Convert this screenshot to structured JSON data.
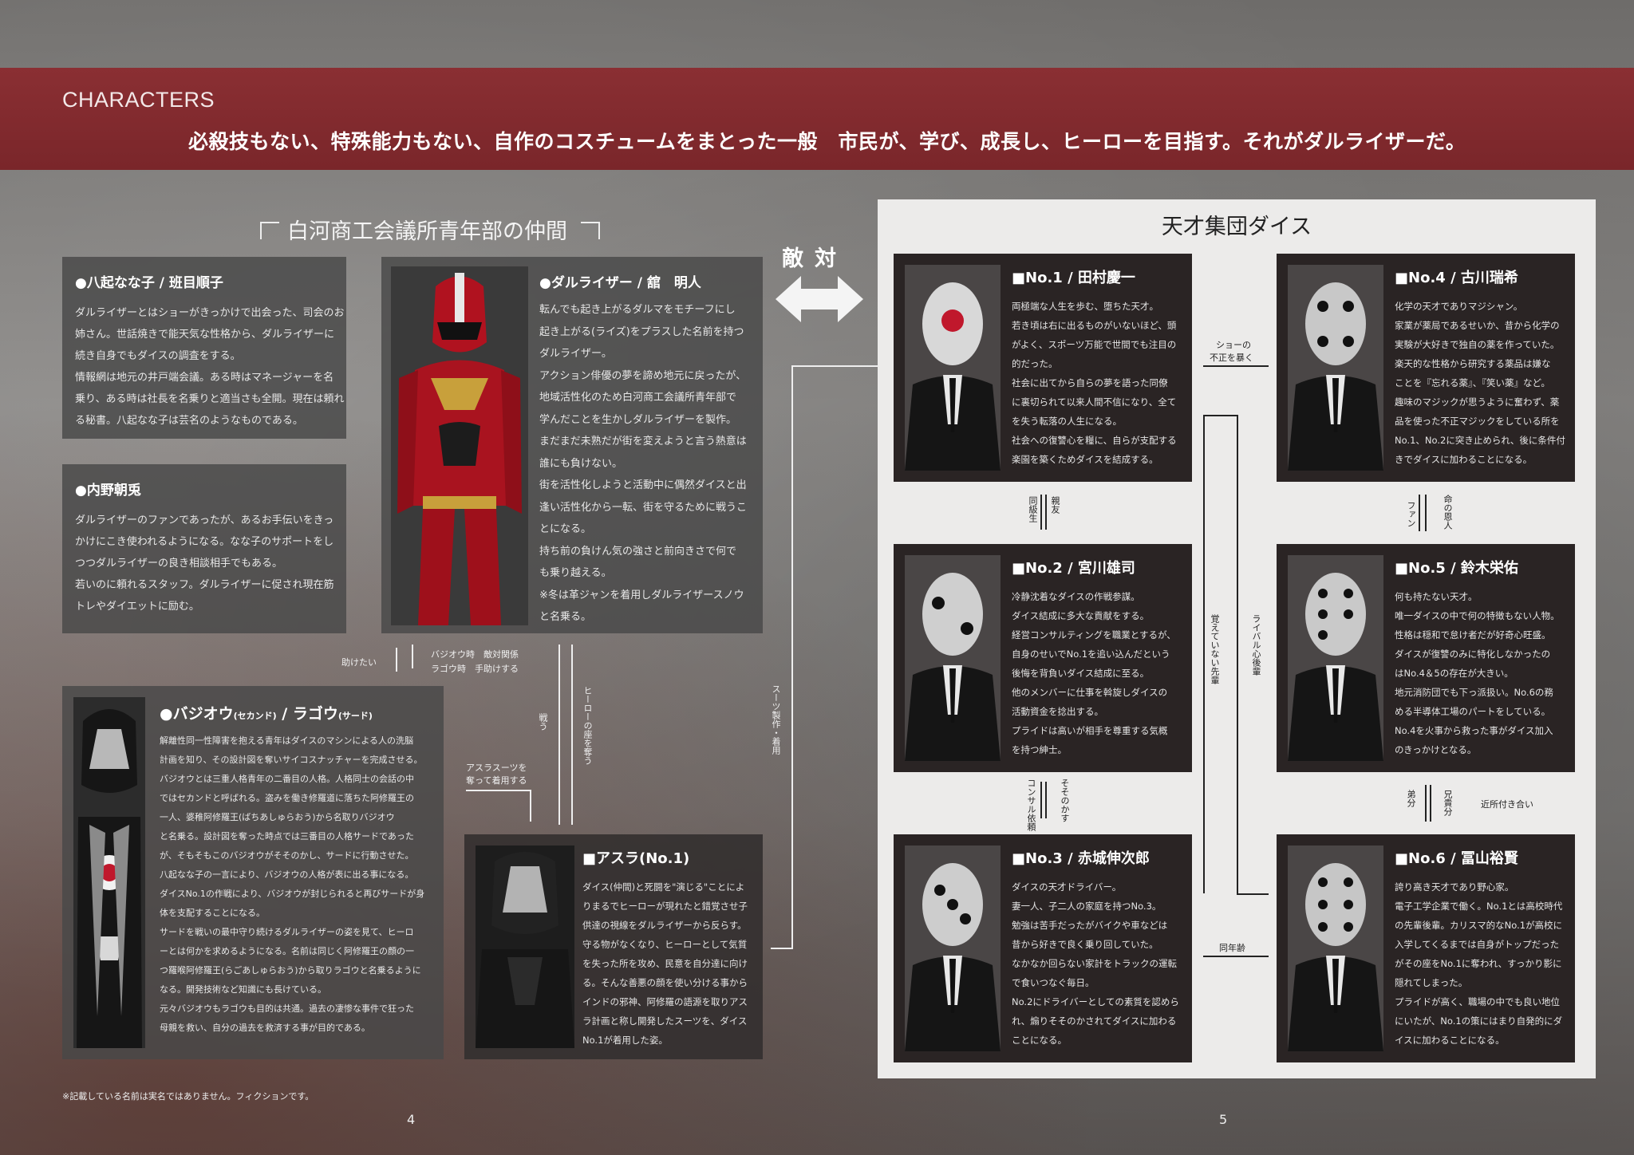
{
  "header": {
    "section_title": "CHARACTERS",
    "tagline": "必殺技もない、特殊能力もない、自作のコスチュームをまとった一般　市民が、学び、成長し、ヒーローを目指す。それがダルライザーだ。"
  },
  "left_group": {
    "title": "白河商工会議所青年部の仲間",
    "cards": [
      {
        "name": "●八起なな子 / 班目順子",
        "lines": [
          "ダルライザーとはショーがきっかけで出会った、司会のお",
          "姉さん。世話焼きで能天気な性格から、ダルライザーに",
          "続き自身でもダイスの調査をする。",
          "情報網は地元の井戸端会議。ある時はマネージャーを名",
          "乗り、ある時は社長を名乗りと適当さも全開。現在は頼れ",
          "る秘書。八起なな子は芸名のようなものである。"
        ]
      },
      {
        "name": "●内野朝兎",
        "lines": [
          "ダルライザーのファンであったが、あるお手伝いをきっ",
          "かけにこき使われるようになる。なな子のサポートをし",
          "つつダルライザーの良き相談相手でもある。",
          "若いのに頼れるスタッフ。ダルライザーに促され現在筋",
          "トレやダイエットに励む。"
        ]
      },
      {
        "name": "●ダルライザー / 舘　明人",
        "lines": [
          "転んでも起き上がるダルマをモチーフにし",
          "起き上がる(ライズ)をプラスした名前を持つ",
          "ダルライザー。",
          "アクション俳優の夢を諦め地元に戻ったが、",
          "地域活性化のため白河商工会議所青年部で",
          "学んだことを生かしダルライザーを製作。",
          "まだまだ未熟だが街を変えようと言う熱意は",
          "誰にも負けない。",
          "街を活性化しようと活動中に偶然ダイスと出",
          "逢い活性化から一転、街を守るために戦うこ",
          "とになる。",
          "持ち前の負けん気の強さと前向きさで何で",
          "も乗り越える。",
          "※冬は革ジャンを着用しダルライザースノウ",
          "と名乗る。"
        ]
      },
      {
        "name_main": "●バジオウ",
        "name_sub1": "(セカンド)",
        "name_mid": " / ラゴウ",
        "name_sub2": "(サード)",
        "lines": [
          "解離性同一性障害を抱える青年はダイスのマシンによる人の洗脳",
          "計画を知り、その設計図を奪いサイコスナッチャーを完成させる。",
          "バジオウとは三重人格青年の二番目の人格。人格同士の会話の中",
          "ではセカンドと呼ばれる。盗みを働き修羅道に落ちた阿修羅王の",
          "一人、婆稚阿修羅王(ばちあしゅらおう)から名取りバジオウ",
          "と名乗る。設計図を奪った時点では三番目の人格サードであった",
          "が、そもそもこのバジオウがそそのかし、サードに行動させた。",
          "八起なな子の一言により、バジオウの人格が表に出る事になる。",
          "ダイスNo.1の作戦により、バジオウが封じられると再びサードが身",
          "体を支配することになる。",
          "サードを戦いの最中守り続けるダルライザーの姿を見て、ヒーロ",
          "ーとは何かを求めるようになる。名前は同じく阿修羅王の顔の一",
          "つ羅喉阿修羅王(らごあしゅらおう)から取りラゴウと名乗るように",
          "なる。開発技術など知識にも長けている。",
          "元々バジオウもラゴウも目的は共通。過去の凄惨な事件で狂った",
          "母親を救い、自分の過去を救済する事が目的である。"
        ]
      },
      {
        "name": "■アスラ(No.1)",
        "lines": [
          "ダイス(仲間)と死闘を\"演じる\"ことによ",
          "りまるでヒーローが現れたと錯覚させ子",
          "供達の視線をダルライザーから反らす。",
          "守る物がなくなり、ヒーローとして気質",
          "を失った所を攻め、民意を自分達に向け",
          "る。そんな善悪の顔を使い分ける事から",
          "インドの邪神、阿修羅の語源を取りアス",
          "ラ計画と称し開発したスーツを、ダイス",
          "No.1が着用した姿。"
        ]
      }
    ],
    "relations": {
      "help": "助けたい",
      "bajio_rel1": "バジオウ時　敵対関係",
      "bajio_rel2": "ラゴウ時　手助けする",
      "asura_wear1": "アスラスーツを",
      "asura_wear2": "奪って着用する",
      "fight": "戦う",
      "hero_seat": "ヒーローの座を奪う",
      "suit": "スーツ製作・着用"
    }
  },
  "enemy_label": "敵対",
  "right_group": {
    "title": "天才集団ダイス",
    "members": [
      {
        "name": "■No.1 / 田村慶一",
        "lines": [
          "両極端な人生を歩む、堕ちた天才。",
          "若き頃は右に出るものがいないほど、頭",
          "がよく、スポーツ万能で世間でも注目の",
          "的だった。",
          "社会に出てから自らの夢を語った同僚",
          "に裏切られて以来人間不信になり、全て",
          "を失う転落の人生になる。",
          "社会への復讐心を糧に、自らが支配する",
          "楽園を築くためダイスを結成する。"
        ]
      },
      {
        "name": "■No.4 / 古川瑞希",
        "lines": [
          "化学の天才でありマジシャン。",
          "家業が薬局であるせいか、昔から化学の",
          "実験が大好きで独自の薬を作っていた。",
          "楽天的な性格から研究する薬品は嫌な",
          "ことを『忘れる薬』、『笑い薬』など。",
          "趣味のマジックが思うように奮わず、薬",
          "品を使った不正マジックをしている所を",
          "No.1、No.2に突き止められ、後に条件付",
          "きでダイスに加わることになる。"
        ]
      },
      {
        "name": "■No.2 / 宮川雄司",
        "lines": [
          "冷静沈着なダイスの作戦参謀。",
          "ダイス結成に多大な貢献をする。",
          "経営コンサルティングを職業とするが、",
          "自身のせいでNo.1を追い込んだという",
          "後悔を背負いダイス結成に至る。",
          "他のメンバーに仕事を斡旋しダイスの",
          "活動資金を捻出する。",
          "プライドは高いが相手を尊重する気概",
          "を持つ紳士。"
        ]
      },
      {
        "name": "■No.5 / 鈴木栄佑",
        "lines": [
          "何も持たない天才。",
          "唯一ダイスの中で何の特徴もない人物。",
          "性格は穏和で怠け者だが好奇心旺盛。",
          "ダイスが復讐のみに特化しなかったの",
          "はNo.4＆5の存在が大きい。",
          "地元消防団でも下っ派扱い。No.6の務",
          "める半導体工場のパートをしている。",
          "No.4を火事から救った事がダイス加入",
          "のきっかけとなる。"
        ]
      },
      {
        "name": "■No.3 / 赤城伸次郎",
        "lines": [
          "ダイスの天才ドライバー。",
          "妻一人、子二人の家庭を持つNo.3。",
          "勉強は苦手だったがバイクや車などは",
          "昔から好きで良く乗り回していた。",
          "なかなか回らない家計をトラックの運転",
          "で食いつなぐ毎日。",
          "No.2にドライバーとしての素質を認めら",
          "れ、煽りそそのかされてダイスに加わる",
          "ことになる。"
        ]
      },
      {
        "name": "■No.6 / 冨山裕賢",
        "lines": [
          "誇り高き天才であり野心家。",
          "電子工学企業で働く。No.1とは高校時代",
          "の先輩後輩。カリスマ的なNo.1が高校に",
          "入学してくるまでは自身がトップだった",
          "がその座をNo.1に奪われ、すっかり影に",
          "隠れてしまった。",
          "プライドが高く、職場の中でも良い地位",
          "にいたが、No.1の策にはまり自発的にダ",
          "イスに加わることになる。"
        ]
      }
    ],
    "relations": {
      "show1": "ショーの",
      "show2": "不正を暴く",
      "classmate": "同級生",
      "friend": "親友",
      "fan": "ファン",
      "savior": "命の恩人",
      "forgot": "覚えていない先輩",
      "rival": "ライバル心後輩",
      "consult": "コンサル依頼",
      "tempt": "そそのかす",
      "younger": "弟分",
      "elder": "兄貴分",
      "neighbors": "近所付き合い",
      "same_age": "同年齢"
    }
  },
  "footer": {
    "note": "※記載している名前は実名ではありません。フィクションです。",
    "page_left": "4",
    "page_right": "5"
  },
  "colors": {
    "header_band": "#7e2a2e",
    "card_gray": "#484848",
    "card_dark": "#2a2424",
    "panel_white": "#ecebea",
    "hero_red": "#c0182c"
  }
}
